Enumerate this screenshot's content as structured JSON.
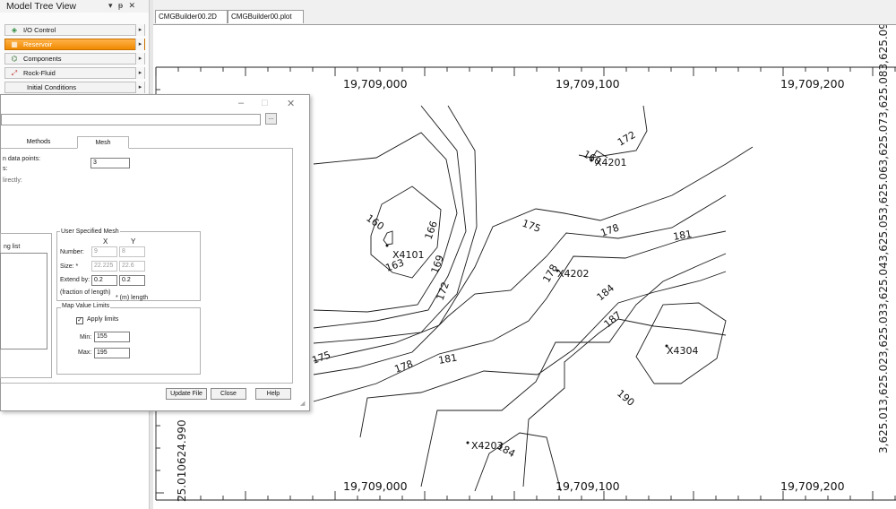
{
  "model_tree": {
    "title": "Model Tree View",
    "controls": "▾ ᵽ ✕",
    "items": [
      {
        "label": "I/O Control",
        "icon": "io-icon",
        "selected": false
      },
      {
        "label": "Reservoir",
        "icon": "reservoir-icon",
        "selected": true
      },
      {
        "label": "Components",
        "icon": "components-icon",
        "selected": false
      },
      {
        "label": "Rock-Fluid",
        "icon": "rockfluid-icon",
        "selected": false
      },
      {
        "label": "Initial Conditions",
        "icon": "",
        "selected": false
      }
    ]
  },
  "doc_tabs": [
    "CMGBuilder00.2D",
    "CMGBuilder00.plot"
  ],
  "dialog": {
    "window_buttons": [
      "–",
      "□",
      "✕"
    ],
    "browse_label": "...",
    "tabs": [
      "Methods",
      "Mesh"
    ],
    "active_tab": "Mesh",
    "data_points_label": "n data points:",
    "data_points_value": "3",
    "s_label": "s:",
    "directly_label": "lirectly:",
    "ng_list_label": "ng list",
    "user_mesh": {
      "title": "User Specified Mesh",
      "col_x": "X",
      "col_y": "Y",
      "number_label": "Number:",
      "number_x": "9",
      "number_y": "8",
      "size_label": "Size: *",
      "size_x": "22.225",
      "size_y": "22.6",
      "extend_label": "Extend by:",
      "extend_x": "0.2",
      "extend_y": "0.2",
      "fraction_label": "(fraction of length)",
      "length_note": "* (m) length"
    },
    "map_limits": {
      "title": "Map Value Limits",
      "apply_label": "Apply limits",
      "apply_checked": true,
      "min_label": "Min:",
      "min_value": "155",
      "max_label": "Max:",
      "max_value": "195"
    },
    "buttons": {
      "update": "Update File",
      "close": "Close",
      "help": "Help"
    }
  },
  "plot": {
    "x_labels_top": [
      "19,709,000",
      "19,709,100",
      "19,709,200"
    ],
    "x_labels_bottom": [
      "19,709,000",
      "19,709,100",
      "19,709,200"
    ],
    "left_labels": [
      "25.010624.990"
    ],
    "right_labels": [
      "3,625.013,625.023,625.033,625.043,625.053,625.063,625.073,625.083,625.093,625.103,625.113,625.123,625.15"
    ],
    "wells": [
      "X4201",
      "X4101",
      "X4202",
      "X4304",
      "X4203"
    ],
    "contour_labels": [
      "160",
      "166",
      "163",
      "169",
      "172",
      "175",
      "178",
      "181",
      "184",
      "187",
      "190",
      "172",
      "175",
      "178",
      "181",
      "184",
      "160",
      "178"
    ]
  },
  "colors": {
    "accent": "#f08a00",
    "line": "#1a1a1a"
  }
}
